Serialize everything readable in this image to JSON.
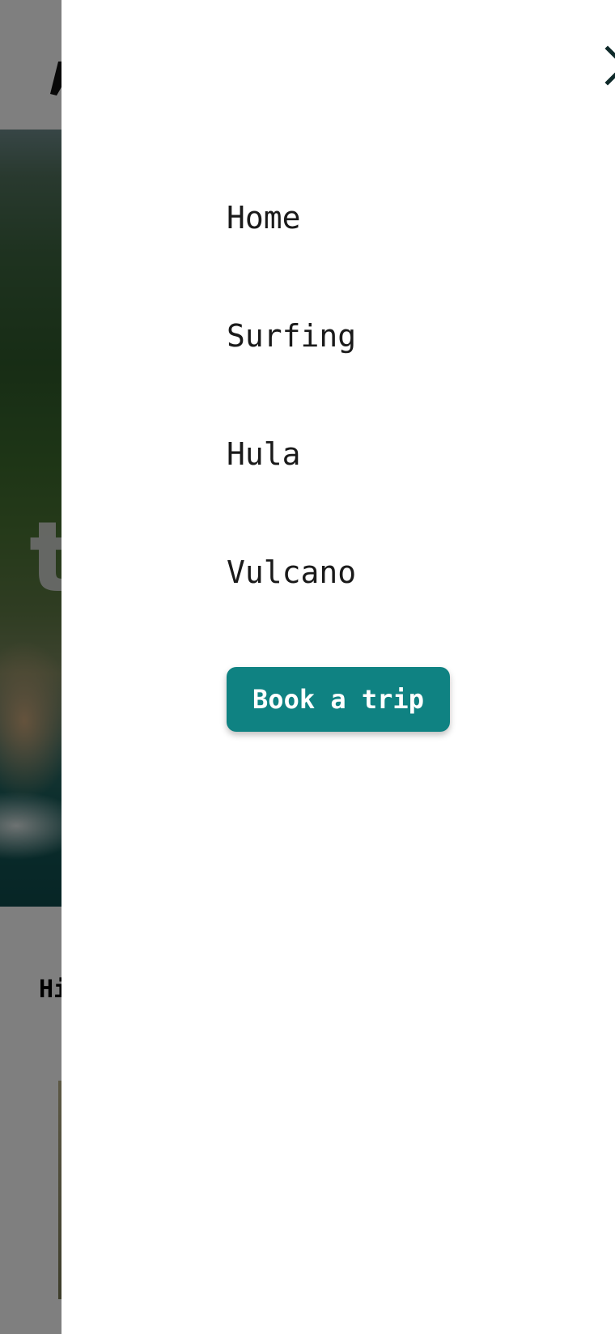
{
  "background": {
    "logo_icon": "airplane-logo-icon",
    "hero_partial_text": "t",
    "section_partial_title": "Hi"
  },
  "drawer": {
    "close_icon": "close-icon",
    "nav": {
      "items": [
        {
          "label": "Home"
        },
        {
          "label": "Surfing"
        },
        {
          "label": "Hula"
        },
        {
          "label": "Vulcano"
        }
      ]
    },
    "cta_label": "Book a trip"
  },
  "colors": {
    "accent": "#0f8282",
    "overlay": "rgba(0,0,0,0.5)",
    "text": "#1a1a1a"
  }
}
